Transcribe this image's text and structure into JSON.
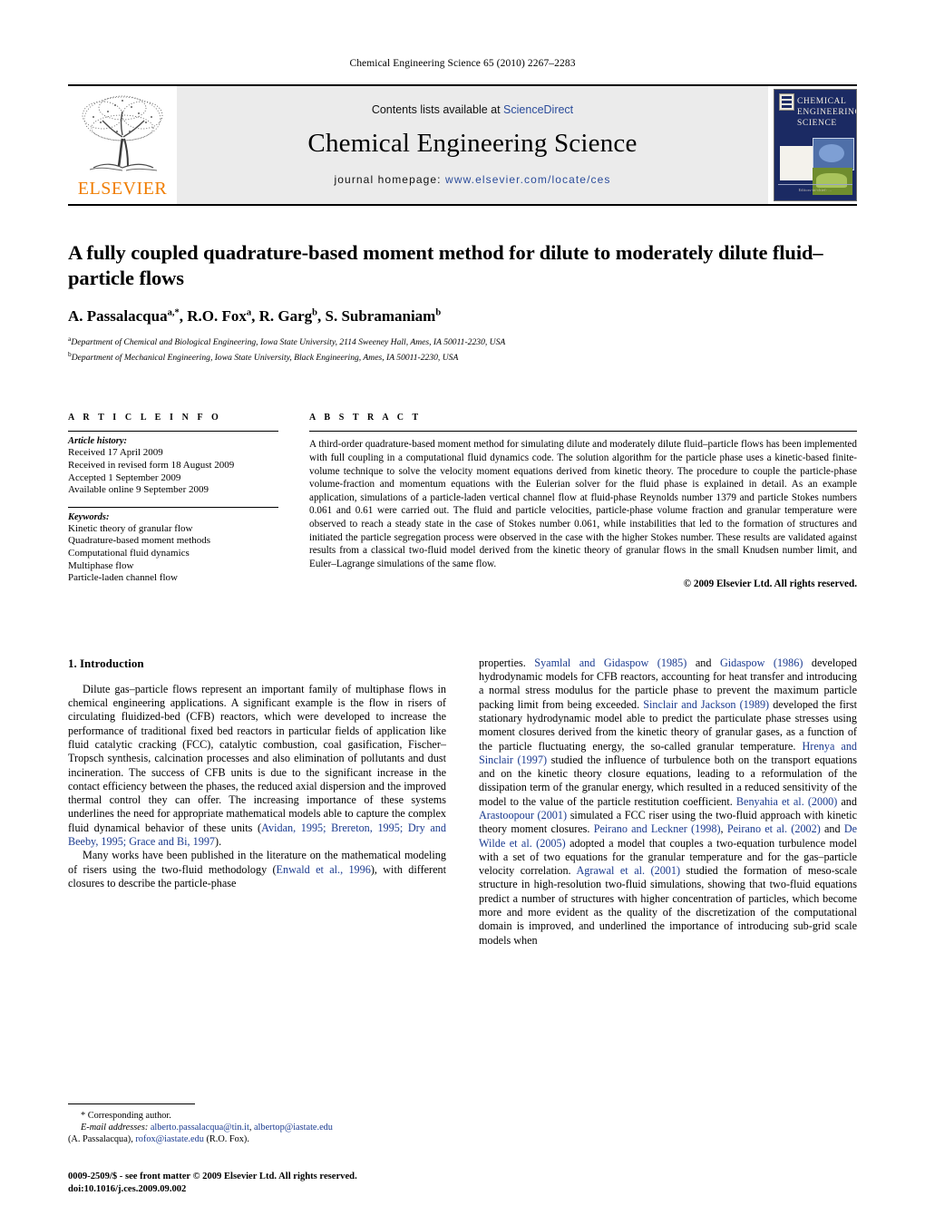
{
  "running_head": "Chemical Engineering Science 65 (2010) 2267–2283",
  "masthead": {
    "publisher_logo_label": "ELSEVIER",
    "contents_prefix": "Contents lists available at ",
    "contents_link": "ScienceDirect",
    "journal_title": "Chemical Engineering Science",
    "homepage_prefix": "journal homepage: ",
    "homepage_url": "www.elsevier.com/locate/ces",
    "cover_title": "CHEMICAL ENGINEERING SCIENCE",
    "cover_footer": "Editors-in-chief: ...",
    "link_color": "#2b4c9b",
    "banner_bg": "#ebebeb",
    "elsevier_orange": "#f07d00"
  },
  "article": {
    "title": "A fully coupled quadrature-based moment method for dilute to moderately dilute fluid–particle flows",
    "authors_html": "A. Passalacqua<sup>a,</sup><sup>*</sup>, R.O. Fox<sup>a</sup>, R. Garg<sup>b</sup>, S. Subramaniam<sup>b</sup>",
    "affiliation_a": "Department of Chemical and Biological Engineering, Iowa State University, 2114 Sweeney Hall, Ames, IA 50011-2230, USA",
    "affiliation_b": "Department of Mechanical Engineering, Iowa State University, Black Engineering, Ames, IA 50011-2230, USA"
  },
  "article_info": {
    "heading": "A R T I C L E    I N F O",
    "history_label": "Article history:",
    "history": [
      "Received 17 April 2009",
      "Received in revised form 18 August 2009",
      "Accepted 1 September 2009",
      "Available online 9 September 2009"
    ],
    "keywords_label": "Keywords:",
    "keywords": [
      "Kinetic theory of granular flow",
      "Quadrature-based moment methods",
      "Computational fluid dynamics",
      "Multiphase flow",
      "Particle-laden channel flow"
    ]
  },
  "abstract": {
    "heading": "A B S T R A C T",
    "text": "A third-order quadrature-based moment method for simulating dilute and moderately dilute fluid–particle flows has been implemented with full coupling in a computational fluid dynamics code. The solution algorithm for the particle phase uses a kinetic-based finite-volume technique to solve the velocity moment equations derived from kinetic theory. The procedure to couple the particle-phase volume-fraction and momentum equations with the Eulerian solver for the fluid phase is explained in detail. As an example application, simulations of a particle-laden vertical channel flow at fluid-phase Reynolds number 1379 and particle Stokes numbers 0.061 and 0.61 were carried out. The fluid and particle velocities, particle-phase volume fraction and granular temperature were observed to reach a steady state in the case of Stokes number 0.061, while instabilities that led to the formation of structures and initiated the particle segregation process were observed in the case with the higher Stokes number. These results are validated against results from a classical two-fluid model derived from the kinetic theory of granular flows in the small Knudsen number limit, and Euler–Lagrange simulations of the same flow.",
    "copyright": "© 2009 Elsevier Ltd. All rights reserved."
  },
  "introduction": {
    "section_number_title": "1. Introduction",
    "left_paragraph_1_a": "Dilute gas–particle flows represent an important family of multiphase flows in chemical engineering applications. A significant example is the flow in risers of circulating fluidized-bed (CFB) reactors, which were developed to increase the performance of traditional fixed bed reactors in particular fields of application like fluid catalytic cracking (FCC), catalytic combustion, coal gasification, Fischer–Tropsch synthesis, calcination processes and also elimination of pollutants and dust incineration. The success of CFB units is due to the significant increase in the contact efficiency between the phases, the reduced axial dispersion and the improved thermal control they can offer. The increasing importance of these systems underlines the need for appropriate mathematical models able to capture the complex fluid dynamical behavior of these units (",
    "left_paragraph_1_cite": "Avidan, 1995; Brereton, 1995; Dry and Beeby, 1995; Grace and Bi, 1997",
    "left_paragraph_1_b": ").",
    "left_paragraph_2_a": "Many works have been published in the literature on the mathematical modeling of risers using the two-fluid methodology (",
    "left_paragraph_2_cite": "Enwald et al., 1996",
    "left_paragraph_2_b": "), with different closures to describe the particle-phase",
    "right_text_1": "properties. ",
    "right_cite_1": "Syamlal and Gidaspow (1985)",
    "right_text_2": " and ",
    "right_cite_2": "Gidaspow (1986)",
    "right_text_3": " developed hydrodynamic models for CFB reactors, accounting for heat transfer and introducing a normal stress modulus for the particle phase to prevent the maximum particle packing limit from being exceeded. ",
    "right_cite_3": "Sinclair and Jackson (1989)",
    "right_text_4": " developed the first stationary hydrodynamic model able to predict the particulate phase stresses using moment closures derived from the kinetic theory of granular gases, as a function of the particle fluctuating energy, the so-called granular temperature. ",
    "right_cite_4": "Hrenya and Sinclair (1997)",
    "right_text_5": " studied the influence of turbulence both on the transport equations and on the kinetic theory closure equations, leading to a reformulation of the dissipation term of the granular energy, which resulted in a reduced sensitivity of the model to the value of the particle restitution coefficient. ",
    "right_cite_5": "Benyahia et al. (2000)",
    "right_text_6": " and ",
    "right_cite_6": "Arastoopour (2001)",
    "right_text_7": " simulated a FCC riser using the two-fluid approach with kinetic theory moment closures. ",
    "right_cite_7": "Peirano and Leckner (1998)",
    "right_text_8": ", ",
    "right_cite_8": "Peirano et al. (2002)",
    "right_text_9": " and ",
    "right_cite_9": "De Wilde et al. (2005)",
    "right_text_10": " adopted a model that couples a two-equation turbulence model with a set of two equations for the granular temperature and for the gas–particle velocity correlation. ",
    "right_cite_10": "Agrawal et al. (2001)",
    "right_text_11": " studied the formation of meso-scale structure in high-resolution two-fluid simulations, showing that two-fluid equations predict a number of structures with higher concentration of particles, which become more and more evident as the quality of the discretization of the computational domain is improved, and underlined the importance of introducing sub-grid scale models when",
    "cite_color": "#1a3a8f"
  },
  "footnotes": {
    "corresponding": "* Corresponding author.",
    "email_label": "E-mail addresses:",
    "email_1": "alberto.passalacqua@tin.it",
    "email_sep_1": ", ",
    "email_2": "albertop@iastate.edu",
    "email_name_1": "(A. Passalacqua), ",
    "email_3": "rofox@iastate.edu",
    "email_name_2": " (R.O. Fox)."
  },
  "imprint": {
    "line_1": "0009-2509/$ - see front matter © 2009 Elsevier Ltd. All rights reserved.",
    "line_2": "doi:10.1016/j.ces.2009.09.002"
  }
}
